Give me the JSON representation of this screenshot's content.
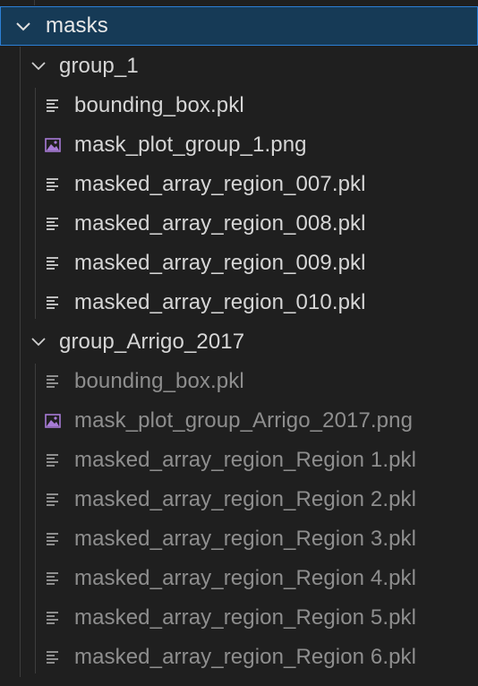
{
  "explorer": {
    "root": {
      "label": "masks",
      "expanded": true
    },
    "groups": [
      {
        "label": "group_1",
        "expanded": true,
        "dimmed": false,
        "files": [
          {
            "name": "bounding_box.pkl",
            "icon": "lines-file-icon"
          },
          {
            "name": "mask_plot_group_1.png",
            "icon": "image-file-icon"
          },
          {
            "name": "masked_array_region_007.pkl",
            "icon": "lines-file-icon"
          },
          {
            "name": "masked_array_region_008.pkl",
            "icon": "lines-file-icon"
          },
          {
            "name": "masked_array_region_009.pkl",
            "icon": "lines-file-icon"
          },
          {
            "name": "masked_array_region_010.pkl",
            "icon": "lines-file-icon"
          }
        ]
      },
      {
        "label": "group_Arrigo_2017",
        "expanded": true,
        "dimmed": true,
        "files": [
          {
            "name": "bounding_box.pkl",
            "icon": "lines-file-icon"
          },
          {
            "name": "mask_plot_group_Arrigo_2017.png",
            "icon": "image-file-icon"
          },
          {
            "name": "masked_array_region_Region 1.pkl",
            "icon": "lines-file-icon"
          },
          {
            "name": "masked_array_region_Region 2.pkl",
            "icon": "lines-file-icon"
          },
          {
            "name": "masked_array_region_Region 3.pkl",
            "icon": "lines-file-icon"
          },
          {
            "name": "masked_array_region_Region 4.pkl",
            "icon": "lines-file-icon"
          },
          {
            "name": "masked_array_region_Region 5.pkl",
            "icon": "lines-file-icon"
          },
          {
            "name": "masked_array_region_Region 6.pkl",
            "icon": "lines-file-icon"
          }
        ]
      }
    ]
  },
  "colors": {
    "background": "#1f1f1f",
    "selection_bg": "#163a56",
    "selection_border": "#2c7fd6",
    "image_icon": "#a77bd6",
    "text": "#d6d6d6",
    "text_dim": "#8e8e8e"
  }
}
